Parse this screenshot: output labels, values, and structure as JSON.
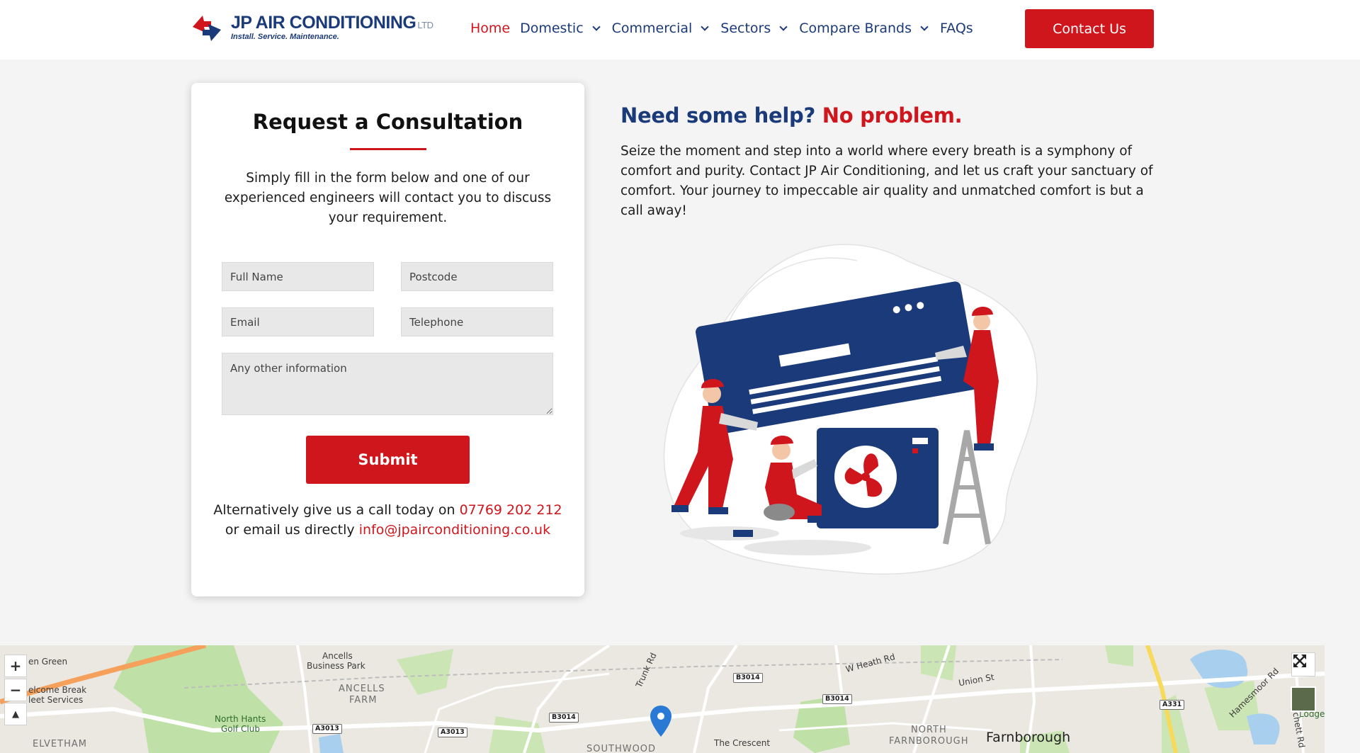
{
  "brand": {
    "name": "JP AIR CONDITIONING",
    "suffix": "LTD",
    "tagline": "Install. Service. Maintenance.",
    "colors": {
      "navy": "#1b3a7a",
      "red": "#d0161d"
    }
  },
  "nav": {
    "items": [
      {
        "label": "Home",
        "active": true,
        "dropdown": false
      },
      {
        "label": "Domestic",
        "active": false,
        "dropdown": true
      },
      {
        "label": "Commercial",
        "active": false,
        "dropdown": true
      },
      {
        "label": "Sectors",
        "active": false,
        "dropdown": true
      },
      {
        "label": "Compare Brands",
        "active": false,
        "dropdown": true
      },
      {
        "label": "FAQs",
        "active": false,
        "dropdown": false
      }
    ],
    "contact_label": "Contact Us"
  },
  "form": {
    "title": "Request a Consultation",
    "intro": "Simply fill in the form below and one of our experienced engineers will contact you to discuss your requirement.",
    "fields": {
      "full_name": "Full Name",
      "postcode": "Postcode",
      "email": "Email",
      "telephone": "Telephone",
      "other": "Any other information"
    },
    "submit_label": "Submit",
    "alt_call_prefix": "Alternatively give us a call today on ",
    "phone": "07769 202 212",
    "alt_email_prefix": "or email us directly ",
    "email": "info@jpairconditioning.co.uk"
  },
  "help": {
    "heading_part1": "Need some help? ",
    "heading_part2": "No problem.",
    "body": "Seize the moment and step into a world where every breath is a symphony of comfort and purity. Contact JP Air Conditioning, and let us craft your sanctuary of comfort. Your journey to impeccable air quality and unmatched comfort is but a call away!"
  },
  "map": {
    "labels": {
      "green": "en Green",
      "welcome": "elcome Break",
      "fleet": "leet Services",
      "ancells_park": "Ancells",
      "ancells_park2": "Business Park",
      "ancells_farm": "ANCELLS",
      "ancells_farm2": "FARM",
      "golf": "North Hants",
      "golf2": "Golf Club",
      "elvetham": "ELVETHAM",
      "trunk": "Trunk Rd",
      "heath": "W Heath Rd",
      "union": "Union St",
      "north_farn": "NORTH",
      "north_farn2": "FARNBOROUGH",
      "farnborough": "Farnborough",
      "crescent": "The Crescent",
      "southwood": "SOUTHWOOD",
      "hamesmoor": "Hamesmoor Rd",
      "mychett": "Mychett Rd",
      "lodge": "Lodge"
    },
    "roads": {
      "a3013a": "A3013",
      "a3013b": "A3013",
      "b3014a": "B3014",
      "b3014b": "B3014",
      "b3014c": "B3014",
      "a331": "A331"
    },
    "controls": {
      "zoom_in": "+",
      "zoom_out": "−",
      "compass": "▲"
    }
  }
}
